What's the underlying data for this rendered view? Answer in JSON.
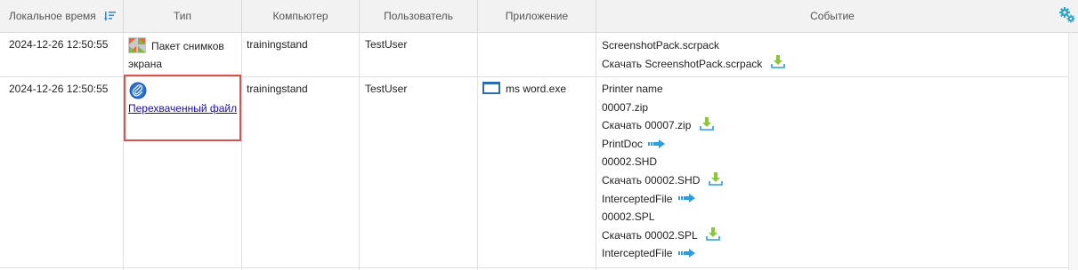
{
  "columns": {
    "time": "Локальное время",
    "type": "Тип",
    "computer": "Компьютер",
    "user": "Пользователь",
    "app": "Приложение",
    "event": "Событие"
  },
  "rows": [
    {
      "time": "2024-12-26 12:50:55",
      "type": "Пакет снимков экрана",
      "computer": "trainingstand",
      "user": "TestUser",
      "app": "",
      "events": [
        "ScreenshotPack.scrpack",
        "Скачать ScreenshotPack.scrpack"
      ]
    },
    {
      "time": "2024-12-26 12:50:55",
      "type_link": "Перехваченный файл",
      "computer": "trainingstand",
      "user": "TestUser",
      "app": "ms word.exe",
      "events": [
        "Printer name",
        "00007.zip",
        "Скачать 00007.zip",
        "PrintDoc",
        "00002.SHD",
        "Скачать 00002.SHD",
        "InterceptedFile",
        "00002.SPL",
        "Скачать 00002.SPL",
        "InterceptedFile"
      ]
    }
  ],
  "icons": {
    "sort": "sort-descending-icon",
    "settings": "gears-icon",
    "screenshot": "screenshot-pack-icon",
    "clip": "paperclip-icon",
    "app": "window-icon",
    "download": "download-icon",
    "arrow": "arrow-right-icon"
  },
  "colors": {
    "header_bg": "#f2f2f2",
    "highlight": "#d9534f",
    "link": "#1a0dab",
    "download_green": "#8cc63f",
    "arrow_blue": "#2b9de0"
  }
}
